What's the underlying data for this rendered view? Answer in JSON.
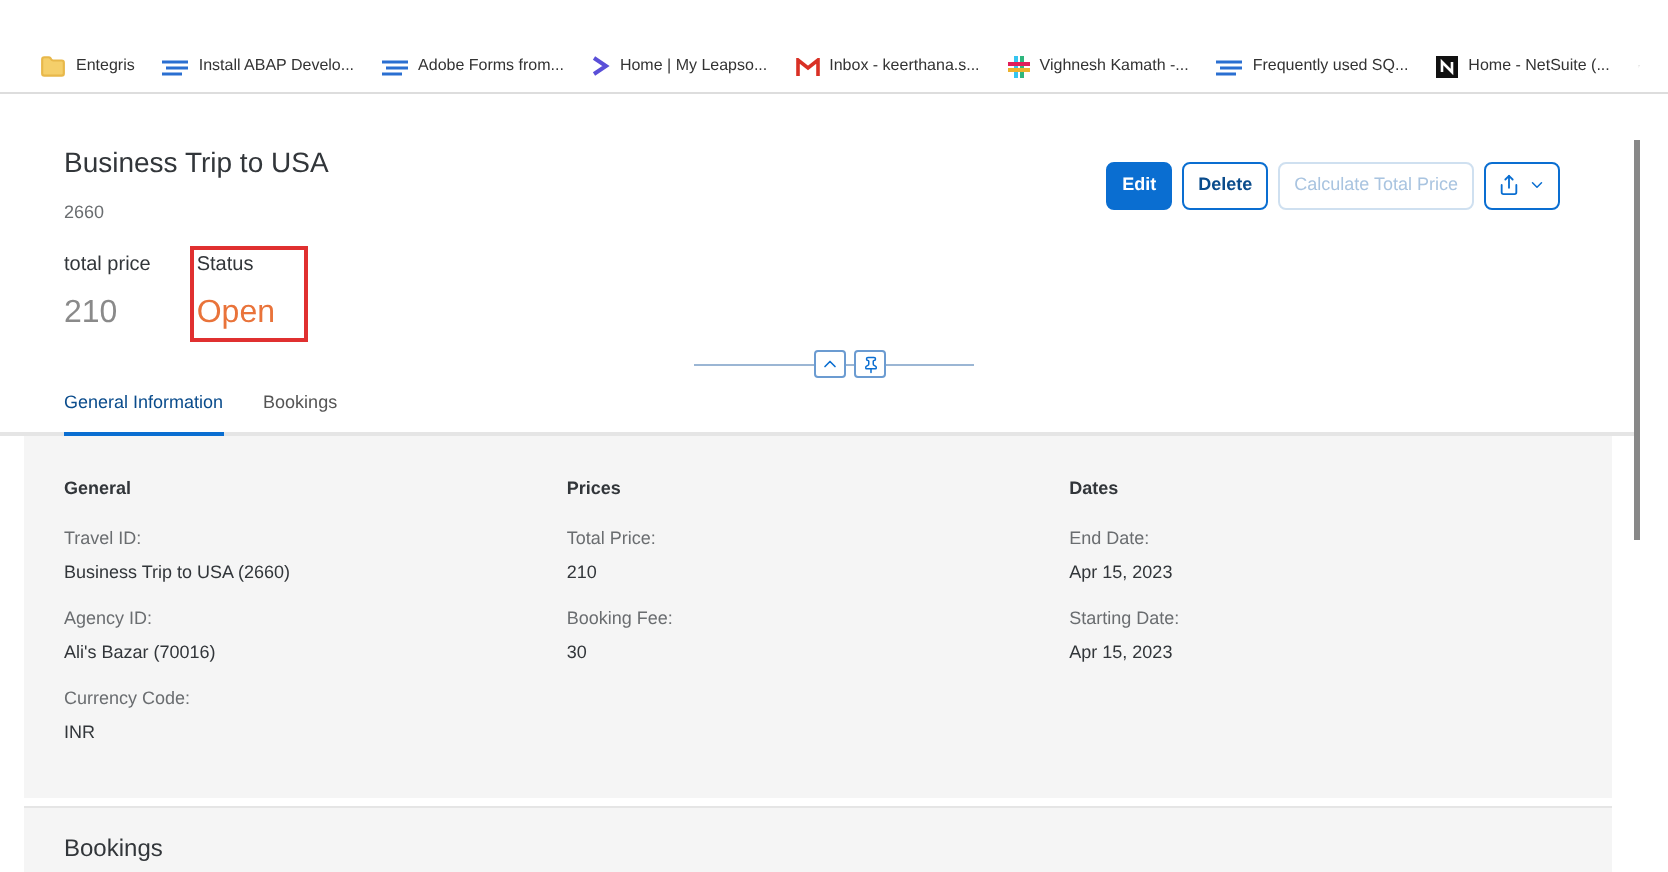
{
  "bookmarks": [
    {
      "label": "Entegris",
      "kind": "folder"
    },
    {
      "label": "Install ABAP Develo...",
      "kind": "sap"
    },
    {
      "label": "Adobe Forms from...",
      "kind": "sap"
    },
    {
      "label": "Home | My Leapso...",
      "kind": "chevron"
    },
    {
      "label": "Inbox - keerthana.s...",
      "kind": "mail"
    },
    {
      "label": "Vighnesh Kamath -...",
      "kind": "slack"
    },
    {
      "label": "Frequently used SQ...",
      "kind": "sap"
    },
    {
      "label": "Home - NetSuite (...",
      "kind": "notion"
    }
  ],
  "header": {
    "title": "Business Trip to USA",
    "subtitle": "2660",
    "kpis": [
      {
        "label": "total price",
        "value": "210",
        "highlighted": false,
        "color": "#8a8a8a"
      },
      {
        "label": "Status",
        "value": "Open",
        "highlighted": true,
        "color": "#e9733a"
      }
    ]
  },
  "actions": [
    {
      "label": "Edit",
      "kind": "primary"
    },
    {
      "label": "Delete",
      "kind": "default"
    },
    {
      "label": "Calculate Total Price",
      "kind": "disabled"
    }
  ],
  "tabs": [
    {
      "label": "General Information",
      "selected": true
    },
    {
      "label": "Bookings",
      "selected": false
    }
  ],
  "groups": [
    {
      "title": "General",
      "fields": [
        {
          "label": "Travel ID:",
          "value": "Business Trip to USA (2660)"
        },
        {
          "label": "Agency ID:",
          "value": "Ali's Bazar (70016)"
        },
        {
          "label": "Currency Code:",
          "value": "INR"
        }
      ]
    },
    {
      "title": "Prices",
      "fields": [
        {
          "label": "Total Price:",
          "value": "210"
        },
        {
          "label": "Booking Fee:",
          "value": "30"
        }
      ]
    },
    {
      "title": "Dates",
      "fields": [
        {
          "label": "End Date:",
          "value": "Apr 15, 2023"
        },
        {
          "label": "Starting Date:",
          "value": "Apr 15, 2023"
        }
      ]
    }
  ],
  "section_title": "Bookings"
}
